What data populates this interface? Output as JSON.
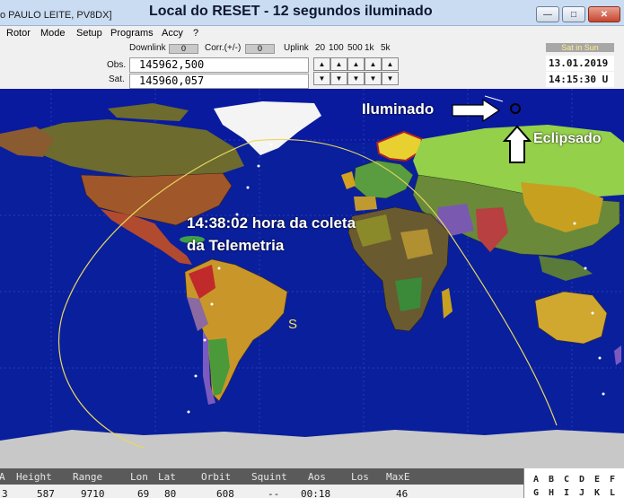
{
  "window": {
    "title_left": "o PAULO LEITE, PV8DX]",
    "title_main": "Local do  RESET - 12 segundos iluminado",
    "min_icon": "minimize-icon",
    "max_icon": "maximize-icon",
    "close_icon": "close-icon"
  },
  "menu": [
    "Rotor",
    "Mode",
    "Setup",
    "Programs",
    "Accy",
    "?"
  ],
  "controls": {
    "downlink_label": "Downlink",
    "downlink_value": "0",
    "corr_label": "Corr.(+/-)",
    "corr_value": "0",
    "uplink_label": "Uplink",
    "steps": [
      "20",
      "100",
      "500",
      "1k",
      "5k"
    ],
    "obs_label": "Obs.",
    "obs_value": "145962,500",
    "sat_label": "Sat.",
    "sat_value": "145960,057",
    "sat_in_sun": "Sat in Sun",
    "date": "13.01.2019",
    "time": "14:15:30 U",
    "arrow_up": "▲",
    "arrow_down": "▼"
  },
  "map": {
    "annotation_iluminado": "Iluminado",
    "annotation_eclipsado": "Eclipsado",
    "annotation_coleta_line1": "14:38:02 hora da coleta",
    "annotation_coleta_line2": "da Telemetria",
    "satellite_letter": "S",
    "colors": {
      "ocean": "#0a1f9c",
      "night_ocean": "#001070",
      "footprint": "#f0e060",
      "arrow": "#ffffff"
    }
  },
  "telemetry": {
    "headers": [
      "A",
      "Height",
      "Range",
      "Lon",
      "Lat",
      "Orbit",
      "Squint",
      "Aos",
      "Los",
      "MaxE"
    ],
    "values": [
      "3",
      "587",
      "9710",
      "69",
      "80",
      "608",
      "--",
      "00:18",
      "",
      "46"
    ]
  },
  "letters": {
    "row1": [
      "A",
      "B",
      "C",
      "D",
      "E",
      "F"
    ],
    "row2": [
      "G",
      "H",
      "I",
      "J",
      "K",
      "L"
    ]
  }
}
